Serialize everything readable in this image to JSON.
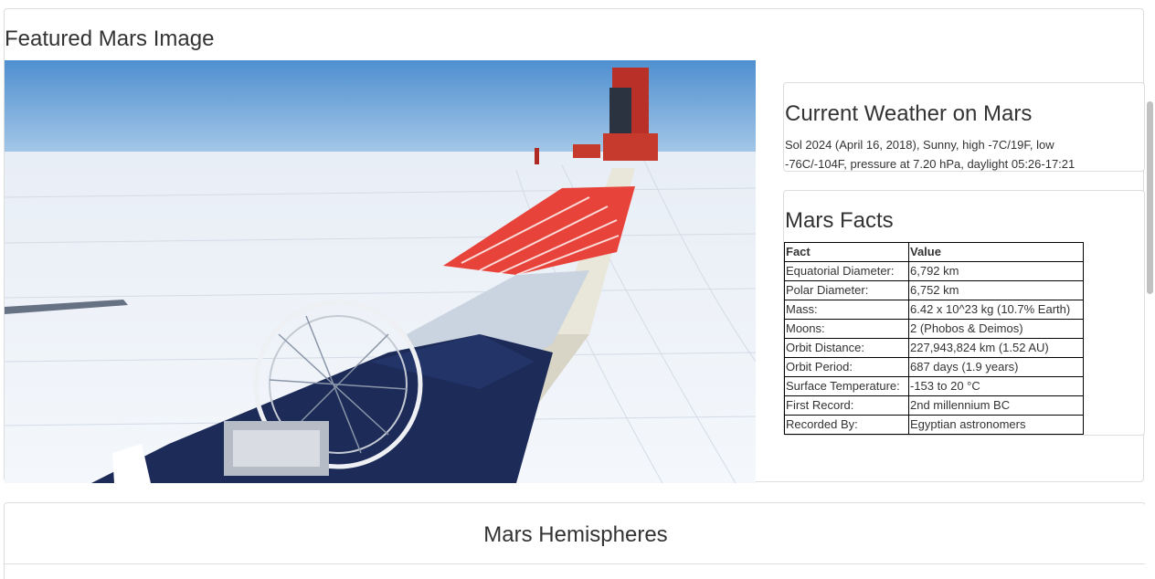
{
  "featured": {
    "title": "Featured Mars Image",
    "image_alt": "Balloon payload laid out on Antarctic ice with launch vehicle in the distance"
  },
  "weather": {
    "title": "Current Weather on Mars",
    "text": "Sol 2024 (April 16, 2018), Sunny, high -7C/19F, low -76C/-104F, pressure at 7.20 hPa, daylight 05:26-17:21"
  },
  "facts": {
    "title": "Mars Facts",
    "headers": [
      "Fact",
      "Value"
    ],
    "rows": [
      [
        "Equatorial Diameter:",
        "6,792 km"
      ],
      [
        "Polar Diameter:",
        "6,752 km"
      ],
      [
        "Mass:",
        "6.42 x 10^23 kg (10.7% Earth)"
      ],
      [
        "Moons:",
        "2 (Phobos & Deimos)"
      ],
      [
        "Orbit Distance:",
        "227,943,824 km (1.52 AU)"
      ],
      [
        "Orbit Period:",
        "687 days (1.9 years)"
      ],
      [
        "Surface Temperature:",
        "-153 to 20 °C"
      ],
      [
        "First Record:",
        "2nd millennium BC"
      ],
      [
        "Recorded By:",
        "Egyptian astronomers"
      ]
    ]
  },
  "hemispheres": {
    "title": "Mars Hemispheres"
  }
}
